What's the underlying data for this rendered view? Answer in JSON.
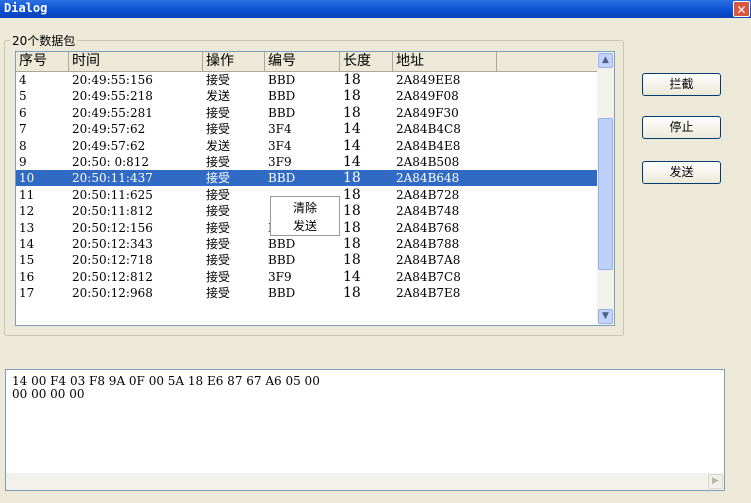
{
  "window": {
    "title": "Dialog",
    "close_glyph": "✕"
  },
  "group": {
    "label": "20个数据包"
  },
  "table": {
    "columns": [
      "序号",
      "时间",
      "操作",
      "编号",
      "长度",
      "地址"
    ],
    "rows": [
      [
        "4",
        "20:49:55:156",
        "接受",
        "BBD",
        "18",
        "2A849EE8"
      ],
      [
        "5",
        "20:49:55:218",
        "发送",
        "BBD",
        "18",
        "2A849F08"
      ],
      [
        "6",
        "20:49:55:281",
        "接受",
        "BBD",
        "18",
        "2A849F30"
      ],
      [
        "7",
        "20:49:57:62",
        "接受",
        "3F4",
        "14",
        "2A84B4C8"
      ],
      [
        "8",
        "20:49:57:62",
        "发送",
        "3F4",
        "14",
        "2A84B4E8"
      ],
      [
        "9",
        "20:50: 0:812",
        "接受",
        "3F9",
        "14",
        "2A84B508"
      ],
      [
        "10",
        "20:50:11:437",
        "接受",
        "BBD",
        "18",
        "2A84B648"
      ],
      [
        "11",
        "20:50:11:625",
        "接受",
        "",
        "18",
        "2A84B728"
      ],
      [
        "12",
        "20:50:11:812",
        "接受",
        "",
        "18",
        "2A84B748"
      ],
      [
        "13",
        "20:50:12:156",
        "接受",
        "BBD",
        "18",
        "2A84B768"
      ],
      [
        "14",
        "20:50:12:343",
        "接受",
        "BBD",
        "18",
        "2A84B788"
      ],
      [
        "15",
        "20:50:12:718",
        "接受",
        "BBD",
        "18",
        "2A84B7A8"
      ],
      [
        "16",
        "20:50:12:812",
        "接受",
        "3F9",
        "14",
        "2A84B7C8"
      ],
      [
        "17",
        "20:50:12:968",
        "接受",
        "BBD",
        "18",
        "2A84B7E8"
      ]
    ],
    "selected_row": "10"
  },
  "context_menu": {
    "items": [
      "清除",
      "发送"
    ]
  },
  "buttons": {
    "intercept": "拦截",
    "stop": "停止",
    "send": "发送"
  },
  "hex": {
    "line1": "14 00 F4 03 F8 9A 0F 00 5A 18 E6 87 67 A6 05 00",
    "line2": "00 00 00 00"
  },
  "icons": {
    "scroll_up": "up-arrow-icon",
    "scroll_down": "down-arrow-icon",
    "scroll_right": "right-arrow-icon"
  },
  "colors": {
    "titlebar": "#0a4fd0",
    "selection": "#316ac5",
    "close": "#d9573c"
  }
}
